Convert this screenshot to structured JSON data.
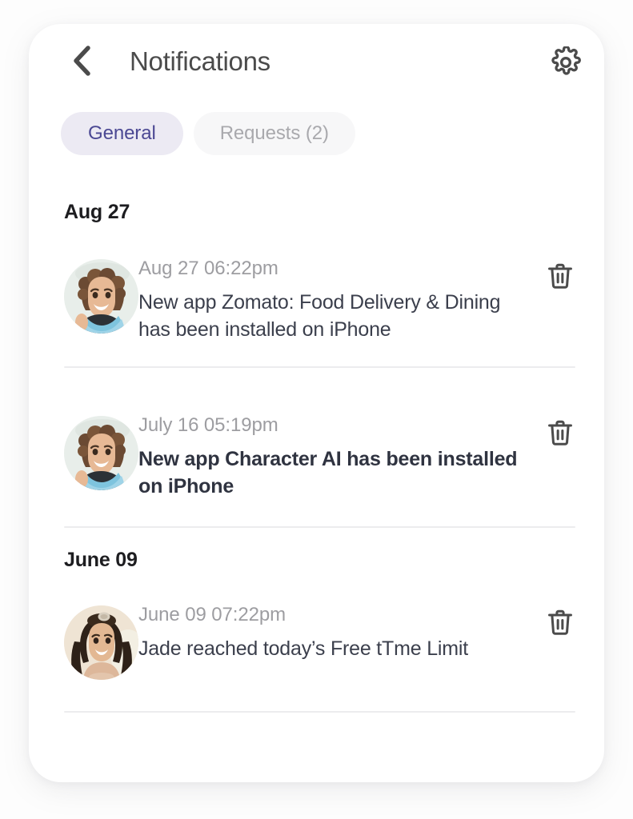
{
  "header": {
    "title": "Notifications",
    "back_icon": "chevron-left-icon",
    "settings_icon": "gear-icon"
  },
  "tabs": [
    {
      "label": "General",
      "active": true
    },
    {
      "label": "Requests (2)",
      "active": false
    }
  ],
  "groups": [
    {
      "date_label": "Aug 27",
      "items": [
        {
          "timestamp": "Aug 27 06:22pm",
          "message": "New app Zomato: Food Delivery & Dining has been installed on iPhone",
          "unread": false,
          "avatar": "boy-curly-hair-mask",
          "delete_icon": "trash-icon"
        },
        {
          "timestamp": "July 16 05:19pm",
          "message": "New app Character AI has been installed on iPhone",
          "unread": true,
          "avatar": "boy-curly-hair-mask",
          "delete_icon": "trash-icon"
        }
      ]
    },
    {
      "date_label": "June 09",
      "items": [
        {
          "timestamp": "June 09 07:22pm",
          "message": "Jade reached today’s Free tTme Limit",
          "unread": false,
          "avatar": "girl-dark-hair-clip",
          "delete_icon": "trash-icon"
        }
      ]
    }
  ],
  "colors": {
    "accent": "#4b4893",
    "tab_active_bg": "#eceaf3",
    "tab_inactive_bg": "#f7f7f8",
    "title": "#4b4b4b",
    "timestamp": "#9d9da1",
    "message": "#3b3f4c",
    "date_header": "#1d1d20",
    "divider": "#ececee",
    "card_bg": "#ffffff",
    "page_bg": "#fdfdfd"
  }
}
